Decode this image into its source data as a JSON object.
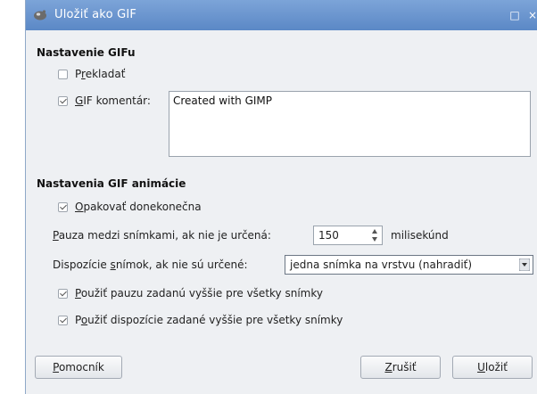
{
  "window": {
    "title": "Uložiť ako GIF",
    "maximize_symbol": "□",
    "close_symbol": "×"
  },
  "gif_settings": {
    "heading": "Nastavenie GIFu",
    "interlace": {
      "label_pre": "P",
      "label_mnemonic": "r",
      "label_post": "ekladať",
      "checked": false
    },
    "gif_comment": {
      "label_mnemonic": "G",
      "label_post": "IF komentár:",
      "checked": true
    },
    "comment_text": "Created with GIMP"
  },
  "animation_settings": {
    "heading": "Nastavenia GIF animácie",
    "loop": {
      "label_mnemonic": "O",
      "label_post": "pakovať donekonečna",
      "checked": true
    },
    "delay": {
      "label_mnemonic": "P",
      "label_post": "auza medzi snímkami, ak nie je určená:",
      "value": "150",
      "unit": "milisekúnd"
    },
    "disposal": {
      "label_pre": "Dispozície ",
      "label_mnemonic": "s",
      "label_post": "nímok, ak nie sú určené:",
      "selected": "jedna snímka na vrstvu (nahradiť)"
    },
    "use_delay": {
      "label_mnemonic": "P",
      "label_post": "oužiť pauzu zadanú vyššie pre všetky snímky",
      "checked": true
    },
    "use_disposal": {
      "label_pre": "P",
      "label_mnemonic": "o",
      "label_post": "užiť dispozície zadané vyššie pre všetky snímky",
      "checked": true
    }
  },
  "buttons": {
    "help": {
      "mnemonic": "P",
      "rest": "omocník"
    },
    "cancel": {
      "mnemonic": "Z",
      "rest": "rušiť"
    },
    "save": {
      "mnemonic": "U",
      "rest": "ložiť"
    }
  },
  "colors": {
    "titlebar": "#6a95cf",
    "window_bg": "#eef0f3"
  },
  "icons": [
    "app-icon",
    "maximize-icon",
    "close-icon",
    "checkbox-icon",
    "spin-arrows-icon",
    "dropdown-arrow-icon"
  ]
}
